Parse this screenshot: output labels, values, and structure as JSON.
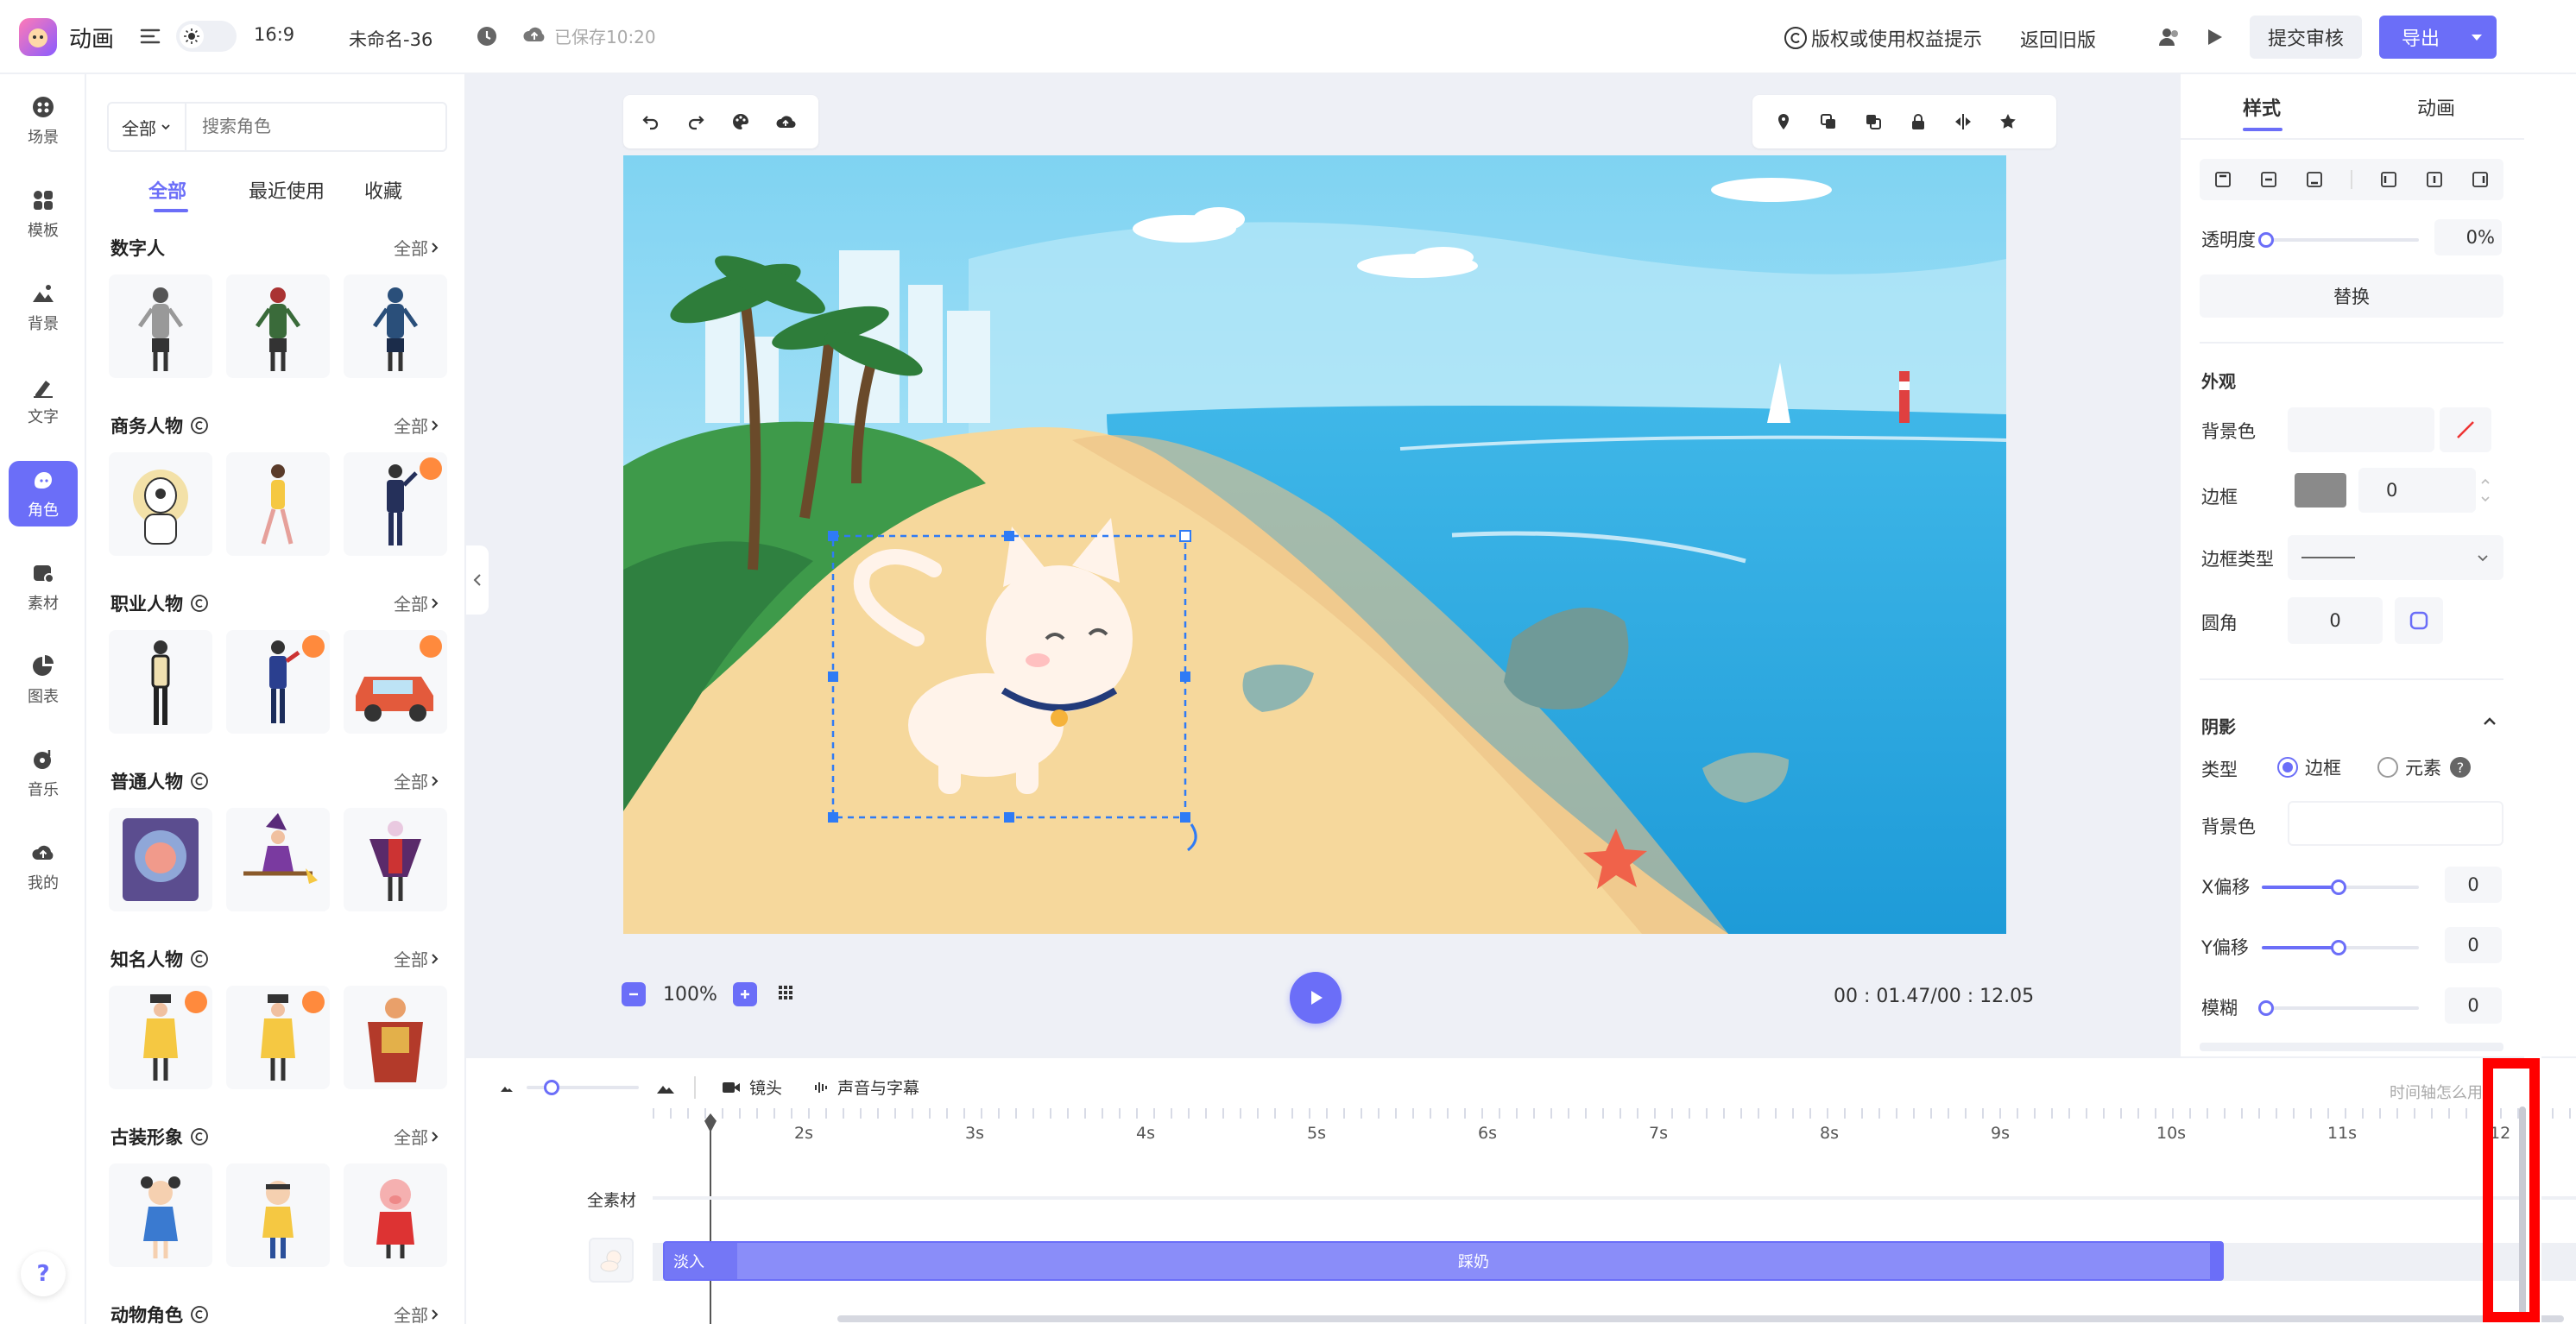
{
  "header": {
    "app_name": "动画",
    "ratio": "16:9",
    "file_name": "未命名-36",
    "saved": "已保存10:20",
    "copyright": "版权或使用权益提示",
    "back_old": "返回旧版",
    "submit": "提交审核",
    "export": "导出"
  },
  "rail": [
    {
      "label": "场景"
    },
    {
      "label": "模板"
    },
    {
      "label": "背景"
    },
    {
      "label": "文字"
    },
    {
      "label": "角色"
    },
    {
      "label": "素材"
    },
    {
      "label": "图表"
    },
    {
      "label": "音乐"
    },
    {
      "label": "我的"
    }
  ],
  "help": "?",
  "panel": {
    "filter": "全部",
    "search_placeholder": "搜索角色",
    "tabs": [
      "全部",
      "最近使用",
      "收藏"
    ],
    "all_label": "全部",
    "sections": [
      "数字人",
      "商务人物",
      "职业人物",
      "普通人物",
      "知名人物",
      "古装形象",
      "动物角色"
    ]
  },
  "canvas": {
    "zoom": "100%",
    "time": "00 : 01.47/00 : 12.05"
  },
  "right": {
    "tabs": [
      "样式",
      "动画"
    ],
    "opacity_label": "透明度",
    "opacity": "0%",
    "replace": "替换",
    "appearance": "外观",
    "bg_label": "背景色",
    "border_label": "边框",
    "border_value": "0",
    "border_type_label": "边框类型",
    "radius_label": "圆角",
    "radius_value": "0",
    "shadow": "阴影",
    "type_label": "类型",
    "type_opt1": "边框",
    "type_opt2": "元素",
    "shadow_bg_label": "背景色",
    "x_offset_label": "X偏移",
    "x_offset": "0",
    "y_offset_label": "Y偏移",
    "y_offset": "0",
    "blur_label": "模糊",
    "blur": "0"
  },
  "timeline": {
    "camera": "镜头",
    "sound": "声音与字幕",
    "help": "时间轴怎么用?",
    "ticks": [
      "2s",
      "3s",
      "4s",
      "5s",
      "6s",
      "7s",
      "8s",
      "9s",
      "10s",
      "11s",
      "12"
    ],
    "track_all": "全素材",
    "fade_in": "淡入",
    "clip_name": "踩奶"
  },
  "colors": {
    "accent": "#6b6ef8",
    "highlight": "#ff0000"
  }
}
